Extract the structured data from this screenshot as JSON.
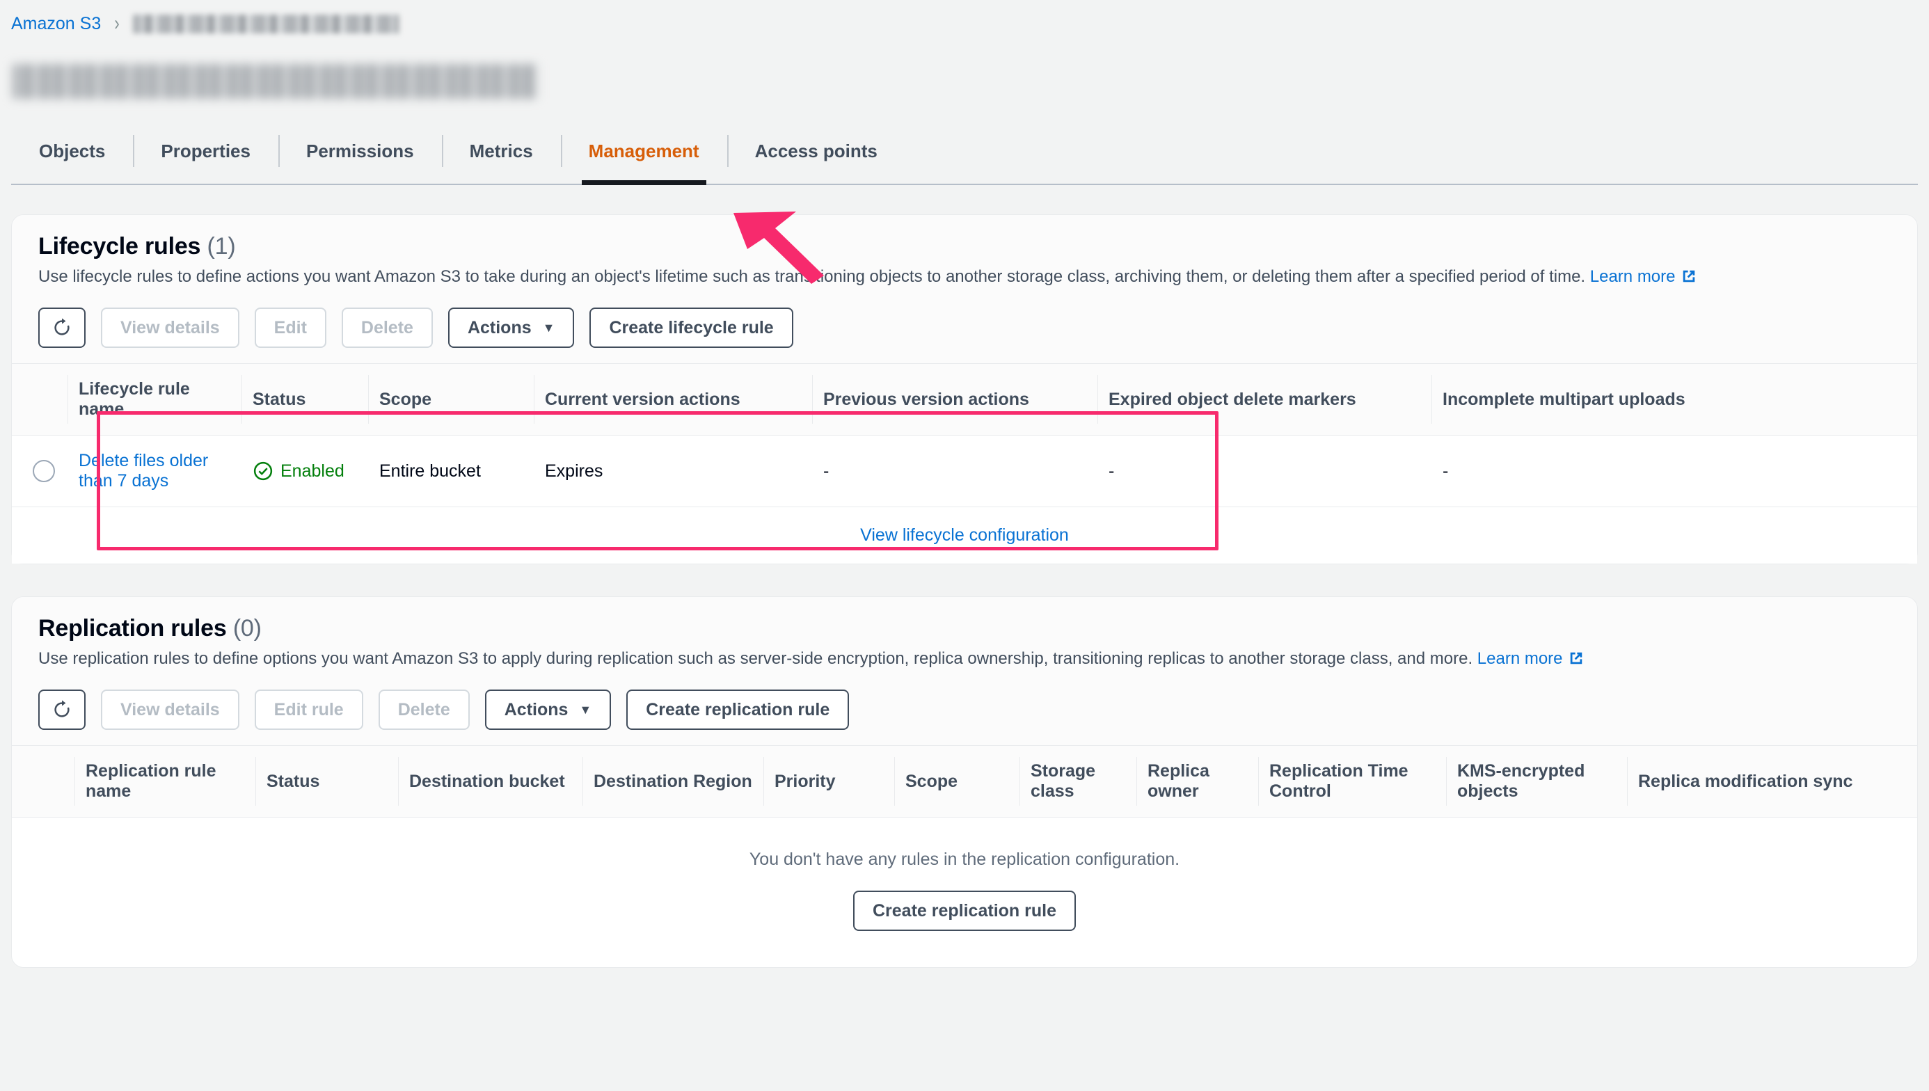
{
  "breadcrumb": {
    "root_label": "Amazon S3",
    "separator": "›",
    "bucket_redacted": true
  },
  "bucket_title_redacted": true,
  "tabs": [
    {
      "label": "Objects",
      "active": false
    },
    {
      "label": "Properties",
      "active": false
    },
    {
      "label": "Permissions",
      "active": false
    },
    {
      "label": "Metrics",
      "active": false
    },
    {
      "label": "Management",
      "active": true
    },
    {
      "label": "Access points",
      "active": false
    }
  ],
  "annotation": {
    "arrow_color": "#f72a6d",
    "points_at": "Management"
  },
  "lifecycle": {
    "title": "Lifecycle rules",
    "count": "(1)",
    "description": "Use lifecycle rules to define actions you want Amazon S3 to take during an object's lifetime such as transitioning objects to another storage class, archiving them, or deleting them after a specified period of time.",
    "learn_more": "Learn more",
    "toolbar": {
      "refresh_label": "⟳",
      "view_details": "View details",
      "edit": "Edit",
      "delete": "Delete",
      "actions": "Actions",
      "create": "Create lifecycle rule"
    },
    "columns": [
      "Lifecycle rule name",
      "Status",
      "Scope",
      "Current version actions",
      "Previous version actions",
      "Expired object delete markers",
      "Incomplete multipart uploads"
    ],
    "rows": [
      {
        "name": "Delete files older than 7 days",
        "status": "Enabled",
        "scope": "Entire bucket",
        "current_version_actions": "Expires",
        "previous_version_actions": "-",
        "expired_object_delete_markers": "-",
        "incomplete_multipart_uploads": "-"
      }
    ],
    "view_configuration_link": "View lifecycle configuration",
    "highlight_color": "#f72a6d"
  },
  "replication": {
    "title": "Replication rules",
    "count": "(0)",
    "description": "Use replication rules to define options you want Amazon S3 to apply during replication such as server-side encryption, replica ownership, transitioning replicas to another storage class, and more.",
    "learn_more": "Learn more",
    "toolbar": {
      "refresh_label": "⟳",
      "view_details": "View details",
      "edit_rule": "Edit rule",
      "delete": "Delete",
      "actions": "Actions",
      "create": "Create replication rule"
    },
    "columns": [
      "Replication rule name",
      "Status",
      "Destination bucket",
      "Destination Region",
      "Priority",
      "Scope",
      "Storage class",
      "Replica owner",
      "Replication Time Control",
      "KMS-encrypted objects",
      "Replica modification sync"
    ],
    "empty_text": "You don't have any rules in the replication configuration.",
    "empty_cta": "Create replication rule"
  },
  "colors": {
    "link": "#0972d3",
    "active_tab": "#d75e09",
    "enabled_green": "#037f0c",
    "annotation_pink": "#f72a6d"
  }
}
